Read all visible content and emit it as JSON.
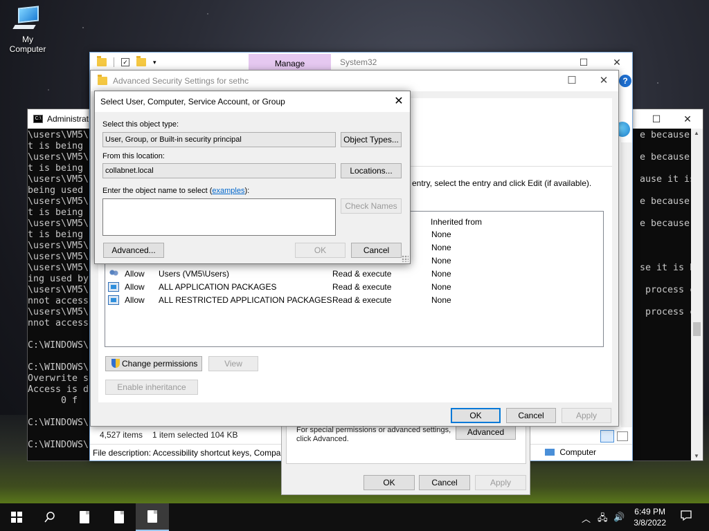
{
  "desktop": {
    "icon_label": "My Computer"
  },
  "cmd": {
    "title": "Administrat",
    "lines": [
      "\\users\\VM5\\",
      "t is being ",
      "\\users\\VM5\\",
      "t is being ",
      "\\users\\VM5\\",
      "being used ",
      "\\users\\VM5\\",
      "t is being ",
      "\\users\\VM5\\",
      "t is being ",
      "\\users\\VM5\\",
      "\\users\\VM5\\",
      "\\users\\VM5\\",
      "ing used by",
      "\\users\\VM5\\",
      "nnot access",
      "\\users\\VM5\\",
      "nnot access",
      "",
      "C:\\WINDOWS\\",
      "",
      "C:\\WINDOWS\\",
      "Overwrite s",
      "Access is d",
      "      0 f",
      "",
      "C:\\WINDOWS\\",
      "",
      "C:\\WINDOWS\\"
    ],
    "right_lines": [
      "e because i",
      "",
      "e because i",
      "",
      "ause it is ",
      "",
      "e because i",
      "",
      "e because i",
      "",
      "",
      "",
      "se it is be",
      "",
      " process ca",
      "",
      " process ca"
    ]
  },
  "explorer": {
    "manage_tab": "Manage",
    "location": "System32",
    "status_items": "4,527 items",
    "status_selected": "1 item selected  104 KB",
    "description": "File description: Accessibility shortcut keys, Compar",
    "computer_label": "Computer"
  },
  "props": {
    "text_line1": "For special permissions or advanced settings,",
    "text_line2": "click Advanced.",
    "advanced_btn": "Advanced",
    "ok": "OK",
    "cancel": "Cancel",
    "apply": "Apply"
  },
  "adv": {
    "title": "Advanced Security Settings for sethc",
    "hint": "entry, select the entry and click Edit (if available).",
    "col_inherited": "Inherited from",
    "entries": [
      {
        "type": "",
        "principal": "",
        "access": "",
        "inherited": "None",
        "icon": ""
      },
      {
        "type": "",
        "principal": "",
        "access": "",
        "inherited": "None",
        "icon": ""
      },
      {
        "type": "",
        "principal": "",
        "access": "",
        "inherited": "None",
        "icon": ""
      },
      {
        "type": "Allow",
        "principal": "Users (VM5\\Users)",
        "access": "Read & execute",
        "inherited": "None",
        "icon": "users-icon"
      },
      {
        "type": "Allow",
        "principal": "ALL APPLICATION PACKAGES",
        "access": "Read & execute",
        "inherited": "None",
        "icon": "package-icon"
      },
      {
        "type": "Allow",
        "principal": "ALL RESTRICTED APPLICATION PACKAGES",
        "access": "Read & execute",
        "inherited": "None",
        "icon": "package-icon"
      }
    ],
    "change_permissions": "Change permissions",
    "view": "View",
    "enable_inheritance": "Enable inheritance",
    "ok": "OK",
    "cancel": "Cancel",
    "apply": "Apply"
  },
  "select_dialog": {
    "title": "Select User, Computer, Service Account, or Group",
    "object_type_label": "Select this object type:",
    "object_type_value": "User, Group, or Built-in security principal",
    "object_types_btn": "Object Types...",
    "location_label": "From this location:",
    "location_value": "collabnet.local",
    "locations_btn": "Locations...",
    "enter_name_label": "Enter the object name to select (",
    "examples_link": "examples",
    "enter_name_suffix": "):",
    "object_name_value": "",
    "check_names_btn": "Check Names",
    "advanced_btn": "Advanced...",
    "ok_btn": "OK",
    "cancel_btn": "Cancel"
  },
  "taskbar": {
    "time": "6:49 PM",
    "date": "3/8/2022"
  },
  "colors": {
    "accent": "#0078d7",
    "manage_tab": "#e5c8f0",
    "link": "#0066cc"
  }
}
